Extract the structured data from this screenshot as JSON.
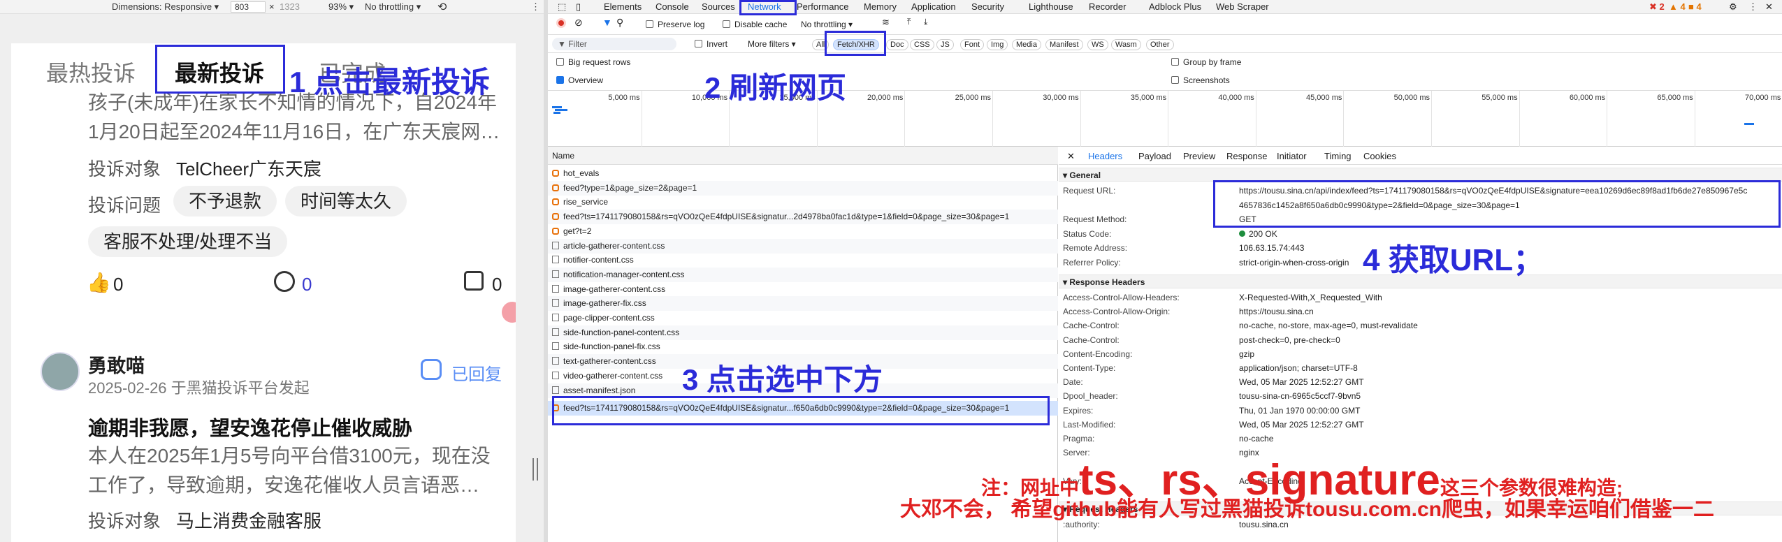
{
  "emulator": {
    "dimensions_label": "Dimensions: Responsive ▾",
    "width": "803",
    "times": "×",
    "height": "1323",
    "zoom": "93% ▾",
    "throttling": "No throttling ▾"
  },
  "page": {
    "tabs": [
      "最热投诉",
      "最新投诉",
      "已完成"
    ],
    "post1": {
      "body_line1": "孩子(未成年)在家长不知情的情况下，自2024年",
      "body_line2": "1月20日起至2024年11月16日，在广东天宸网…",
      "target_label": "投诉对象",
      "target_value": "TelCheer广东天宸",
      "issue_label": "投诉问题",
      "tags": [
        "不予退款",
        "时间等太久",
        "客服不处理/处理不当"
      ],
      "likes": "0",
      "comments": "0",
      "shares": "0"
    },
    "post2": {
      "author": "勇敢喵",
      "date_source": "2025-02-26 于黑猫投诉平台发起",
      "status": "已回复",
      "title": "逾期非我愿，望安逸花停止催收威胁",
      "body_line1": "本人在2025年1月5号向平台借3100元，现在没",
      "body_line2": "工作了，导致逾期，安逸花催收人员言语恶…",
      "target_label": "投诉对象",
      "target_value": "马上消费金融客服"
    }
  },
  "devtools": {
    "tabs": [
      "Elements",
      "Console",
      "Sources",
      "Network",
      "Performance",
      "Memory",
      "Application",
      "Security",
      "Lighthouse",
      "Recorder",
      "Adblock Plus",
      "Web Scraper"
    ],
    "badges": {
      "errors": "2",
      "warnings": "4",
      "info": "4"
    },
    "toolbar": {
      "preserve_log": "Preserve log",
      "disable_cache": "Disable cache",
      "throttling": "No throttling"
    },
    "filter": {
      "placeholder": "Filter",
      "invert": "Invert",
      "more_filters": "More filters ▾",
      "types": [
        "All",
        "Fetch/XHR",
        "Doc",
        "CSS",
        "JS",
        "Font",
        "Img",
        "Media",
        "Manifest",
        "WS",
        "Wasm",
        "Other"
      ]
    },
    "options": {
      "big_rows": "Big request rows",
      "overview": "Overview",
      "group_by_frame": "Group by frame",
      "screenshots": "Screenshots"
    },
    "timeline_ticks": [
      "5,000 ms",
      "10,000 ms",
      "15,000 ms",
      "20,000 ms",
      "25,000 ms",
      "30,000 ms",
      "35,000 ms",
      "40,000 ms",
      "45,000 ms",
      "50,000 ms",
      "55,000 ms",
      "60,000 ms",
      "65,000 ms",
      "70,000 ms"
    ],
    "list": {
      "column": "Name",
      "rows": [
        {
          "name": "hot_evals",
          "kind": "xhr"
        },
        {
          "name": "feed?type=1&page_size=2&page=1",
          "kind": "xhr"
        },
        {
          "name": "rise_service",
          "kind": "xhr"
        },
        {
          "name": "feed?ts=1741179080158&rs=qVO0zQeE4fdpUISE&signatur...2d4978ba0fac1d&type=1&field=0&page_size=30&page=1",
          "kind": "xhr"
        },
        {
          "name": "get?t=2",
          "kind": "xhr"
        },
        {
          "name": "article-gatherer-content.css",
          "kind": "doc"
        },
        {
          "name": "notifier-content.css",
          "kind": "doc"
        },
        {
          "name": "notification-manager-content.css",
          "kind": "doc"
        },
        {
          "name": "image-gatherer-content.css",
          "kind": "doc"
        },
        {
          "name": "image-gatherer-fix.css",
          "kind": "doc"
        },
        {
          "name": "page-clipper-content.css",
          "kind": "doc"
        },
        {
          "name": "side-function-panel-content.css",
          "kind": "doc"
        },
        {
          "name": "side-function-panel-fix.css",
          "kind": "doc"
        },
        {
          "name": "text-gatherer-content.css",
          "kind": "doc"
        },
        {
          "name": "video-gatherer-content.css",
          "kind": "doc"
        },
        {
          "name": "asset-manifest.json",
          "kind": "doc"
        }
      ],
      "selected": "feed?ts=1741179080158&rs=qVO0zQeE4fdpUISE&signatur...f650a6db0c9990&type=2&field=0&page_size=30&page=1"
    },
    "details": {
      "tabs": [
        "Headers",
        "Payload",
        "Preview",
        "Response",
        "Initiator",
        "Timing",
        "Cookies"
      ],
      "general_title": "▾ General",
      "general": [
        {
          "k": "Request URL:",
          "v": "https://tousu.sina.cn/api/index/feed?ts=1741179080158&rs=qVO0zQeE4fdpUISE&signature=eea10269d6ec89f8ad1fb6de27e850967e5c"
        },
        {
          "k": "",
          "v": "4657836c1452a8f650a6db0c9990&type=2&field=0&page_size=30&page=1"
        },
        {
          "k": "Request Method:",
          "v": "GET"
        },
        {
          "k": "Status Code:",
          "v": "200 OK"
        },
        {
          "k": "Remote Address:",
          "v": "106.63.15.74:443"
        },
        {
          "k": "Referrer Policy:",
          "v": "strict-origin-when-cross-origin"
        }
      ],
      "response_title": "▾ Response Headers",
      "response": [
        {
          "k": "Access-Control-Allow-Headers:",
          "v": "X-Requested-With,X_Requested_With"
        },
        {
          "k": "Access-Control-Allow-Origin:",
          "v": "https://tousu.sina.cn"
        },
        {
          "k": "Cache-Control:",
          "v": "no-cache, no-store, max-age=0, must-revalidate"
        },
        {
          "k": "Cache-Control:",
          "v": "post-check=0, pre-check=0"
        },
        {
          "k": "Content-Encoding:",
          "v": "gzip"
        },
        {
          "k": "Content-Type:",
          "v": "application/json; charset=UTF-8"
        },
        {
          "k": "Date:",
          "v": "Wed, 05 Mar 2025 12:52:27 GMT"
        },
        {
          "k": "Dpool_header:",
          "v": "tousu-sina-cn-6965c5ccf7-9bvn5"
        },
        {
          "k": "Expires:",
          "v": "Thu, 01 Jan 1970 00:00:00 GMT"
        },
        {
          "k": "Last-Modified:",
          "v": "Wed, 05 Mar 2025 12:52:27 GMT"
        },
        {
          "k": "Pragma:",
          "v": "no-cache"
        },
        {
          "k": "Server:",
          "v": "nginx"
        },
        {
          "k": "",
          "v": ""
        },
        {
          "k": "Vary:",
          "v": "Accept-Encoding"
        },
        {
          "k": "",
          "v": ""
        }
      ],
      "request_title": "▾ Request Headers",
      "request": [
        {
          "k": ":authority:",
          "v": "tousu.sina.cn"
        }
      ]
    }
  },
  "annotations": {
    "step1": "1 点击最新投诉",
    "step2": "2 刷新网页",
    "step3": "3 点击选中下方",
    "step4": "4 获取URL；",
    "note_prefix": "注：网址中",
    "note_big": "ts、rs、signature",
    "note_suffix": "这三个参数很难构造;",
    "note_line2": "大邓不会，  希望github能有人写过黑猫投诉tousu.com.cn爬虫，如果幸运咱们借鉴一二"
  }
}
